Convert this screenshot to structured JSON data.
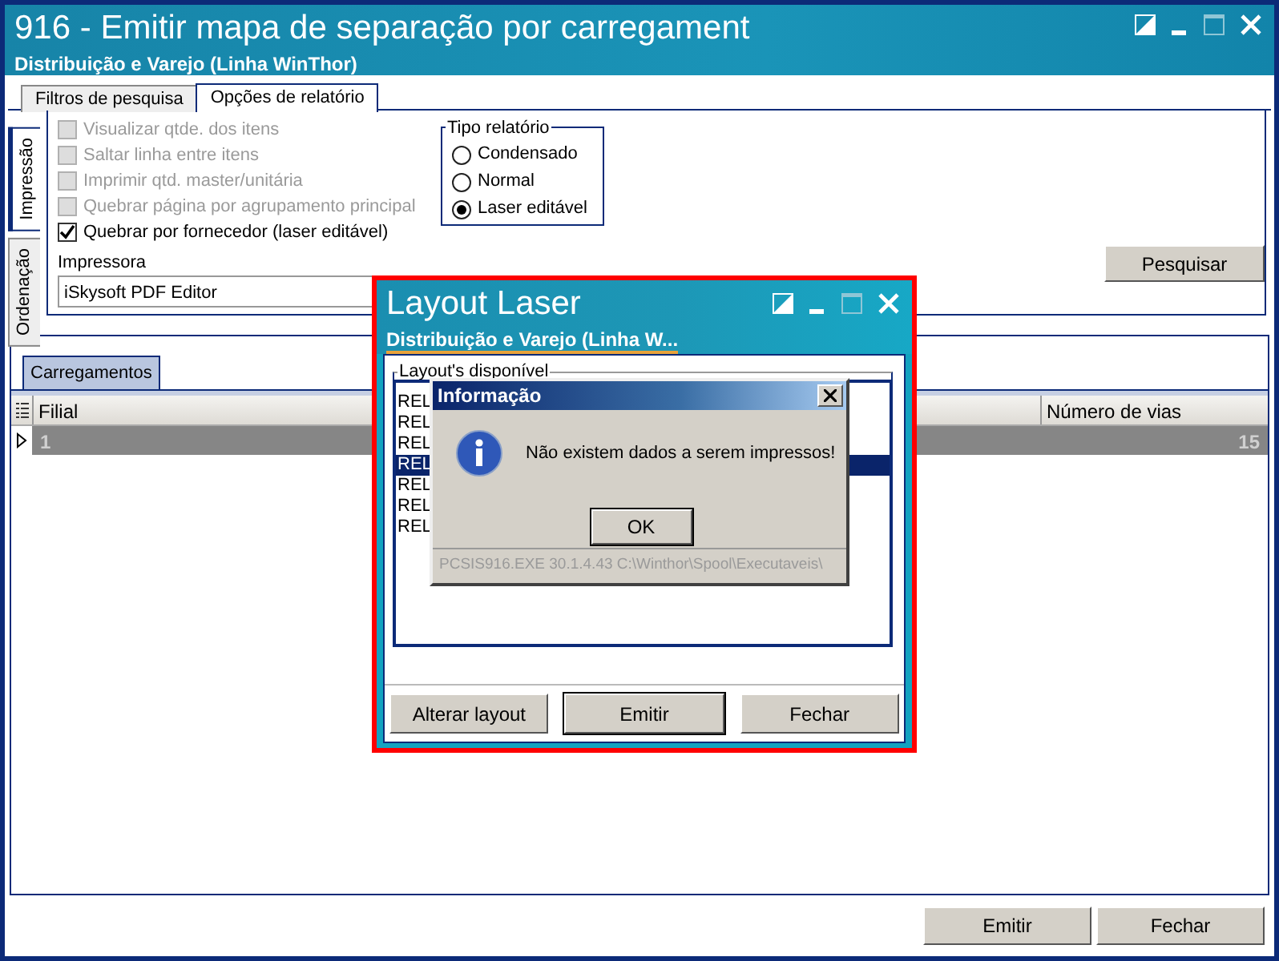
{
  "window": {
    "title": "916 - Emitir mapa de separação por carregament",
    "subtitle": "Distribuição e Varejo (Linha WinThor)"
  },
  "tabs": [
    {
      "label": "Filtros de pesquisa",
      "selected": false
    },
    {
      "label": "Opções de relatório",
      "selected": true
    }
  ],
  "side_tabs": [
    {
      "label": "Impressão",
      "selected": true
    },
    {
      "label": "Ordenação",
      "selected": false
    }
  ],
  "options": [
    {
      "label": "Visualizar qtde. dos itens",
      "checked": false,
      "disabled": true
    },
    {
      "label": "Saltar linha entre itens",
      "checked": false,
      "disabled": true
    },
    {
      "label": "Imprimir qtd. master/unitária",
      "checked": false,
      "disabled": true
    },
    {
      "label": "Quebrar página por agrupamento principal",
      "checked": false,
      "disabled": true
    },
    {
      "label": "Quebrar por fornecedor (laser editável)",
      "checked": true,
      "disabled": false
    }
  ],
  "report_type": {
    "title": "Tipo relatório",
    "options": [
      {
        "label": "Condensado",
        "selected": false
      },
      {
        "label": "Normal",
        "selected": false
      },
      {
        "label": "Laser editável",
        "selected": true
      }
    ]
  },
  "printer": {
    "label": "Impressora",
    "value": "iSkysoft PDF Editor"
  },
  "search_button": "Pesquisar",
  "results": {
    "tab": "Carregamentos",
    "columns": [
      "Filial",
      "Número de vias"
    ],
    "rows": [
      {
        "cells": [
          "1",
          "15"
        ],
        "selected": true
      }
    ]
  },
  "footer_buttons": [
    "Emitir",
    "Fechar"
  ],
  "layout_dialog": {
    "title": "Layout Laser",
    "subtitle": "Distribuição e Varejo (Linha W...",
    "group_label": "Layout's disponível",
    "items": [
      {
        "label": "REL",
        "selected": false
      },
      {
        "label": "REL",
        "selected": false
      },
      {
        "label": "REL",
        "selected": false
      },
      {
        "label": "REL",
        "selected": true
      },
      {
        "label": "REL",
        "selected": false
      },
      {
        "label": "REL",
        "selected": false
      },
      {
        "label": "REL",
        "selected": false
      }
    ],
    "buttons": [
      "Alterar layout",
      "Emitir",
      "Fechar"
    ]
  },
  "message_dialog": {
    "title": "Informação",
    "message": "Não existem dados a serem impressos!",
    "button": "OK",
    "footer": "PCSIS916.EXE 30.1.4.43 C:\\Winthor\\Spool\\Executaveis\\"
  }
}
